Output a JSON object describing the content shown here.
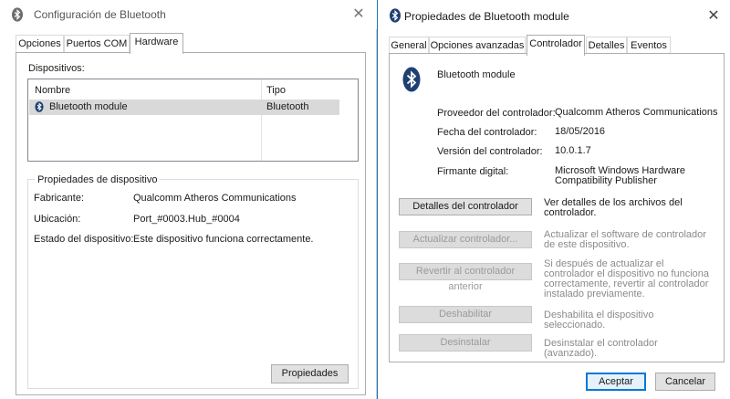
{
  "colors": {
    "bluetooth_icon": "#1f3f73",
    "selection": "#d9d9d9",
    "default_button_border": "#0078d7"
  },
  "left_window": {
    "title": "Configuración de Bluetooth",
    "close_glyph": "✕",
    "tabs": [
      {
        "label": "Opciones",
        "active": false
      },
      {
        "label": "Puertos COM",
        "active": false
      },
      {
        "label": "Hardware",
        "active": true
      }
    ],
    "devices_label": "Dispositivos:",
    "devices_table": {
      "columns": [
        "Nombre",
        "Tipo"
      ],
      "rows": [
        {
          "name": "Bluetooth module",
          "type": "Bluetooth",
          "icon": "bluetooth-icon",
          "selected": true
        }
      ]
    },
    "device_properties": {
      "legend": "Propiedades de dispositivo",
      "fields": [
        {
          "label": "Fabricante:",
          "value": "Qualcomm Atheros Communications"
        },
        {
          "label": "Ubicación:",
          "value": "Port_#0003.Hub_#0004"
        },
        {
          "label": "Estado del dispositivo:",
          "value": "Este dispositivo funciona correctamente."
        }
      ],
      "button_label": "Propiedades"
    }
  },
  "right_window": {
    "title": "Propiedades de Bluetooth module",
    "close_glyph": "✕",
    "tabs": [
      {
        "label": "General",
        "active": false
      },
      {
        "label": "Opciones avanzadas",
        "active": false
      },
      {
        "label": "Controlador",
        "active": true
      },
      {
        "label": "Detalles",
        "active": false
      },
      {
        "label": "Eventos",
        "active": false
      }
    ],
    "device_name": "Bluetooth module",
    "driver_info": [
      {
        "label": "Proveedor del controlador:",
        "value": "Qualcomm Atheros Communications"
      },
      {
        "label": "Fecha del controlador:",
        "value": "18/05/2016"
      },
      {
        "label": "Versión del controlador:",
        "value": "10.0.1.7"
      },
      {
        "label": "Firmante digital:",
        "value": "Microsoft Windows Hardware Compatibility Publisher"
      }
    ],
    "actions": [
      {
        "button": "Detalles del controlador",
        "description": "Ver detalles de los archivos del controlador.",
        "enabled": true
      },
      {
        "button": "Actualizar controlador...",
        "description": "Actualizar el software de controlador de este dispositivo.",
        "enabled": false
      },
      {
        "button": "Revertir al controlador anterior",
        "description": "Si después de actualizar el controlador el dispositivo no funciona correctamente, revertir al controlador instalado previamente.",
        "enabled": false
      },
      {
        "button": "Deshabilitar",
        "description": "Deshabilita el dispositivo seleccionado.",
        "enabled": false
      },
      {
        "button": "Desinstalar",
        "description": "Desinstalar el controlador (avanzado).",
        "enabled": false
      }
    ],
    "ok_label": "Aceptar",
    "cancel_label": "Cancelar"
  }
}
